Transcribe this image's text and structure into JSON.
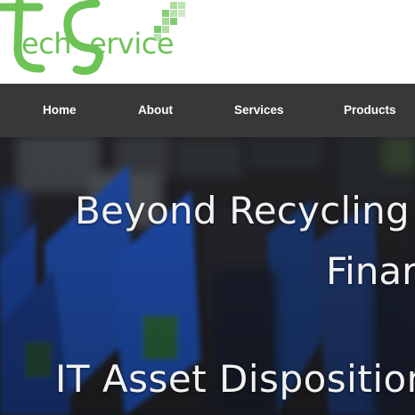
{
  "logo": {
    "prefix": "ech",
    "suffix": "ervice",
    "brand_color": "#6dc356"
  },
  "nav": {
    "items": [
      {
        "label": "Home"
      },
      {
        "label": "About"
      },
      {
        "label": "Services"
      },
      {
        "label": "Products"
      }
    ]
  },
  "hero": {
    "headline": "Beyond Recycling",
    "subline": "Finar",
    "tagline": "IT Asset Disposition S"
  },
  "colors": {
    "nav_background": "#383838",
    "nav_text": "#ffffff",
    "hero_text": "#f2f2f2"
  }
}
